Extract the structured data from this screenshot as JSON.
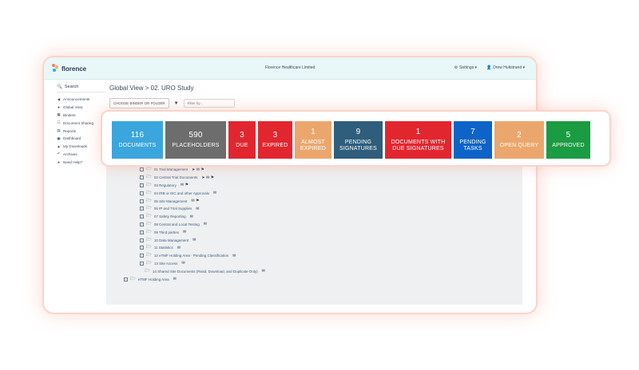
{
  "colors": {
    "documents": "#3aa6dd",
    "placeholders": "#6d6d6d",
    "due": "#e2262f",
    "expired": "#e2262f",
    "almost_expired": "#eba66d",
    "pending_signatures": "#2f5d7c",
    "docs_due_signatures": "#e2262f",
    "pending_tasks": "#0d63c8",
    "open_query": "#eba66d",
    "approved": "#1b9b42"
  },
  "app": {
    "logo_text": "florence",
    "org_name": "Florence Healthcare Limited",
    "settings_label": "Settings ▾",
    "user_label": "Drew Hultstrand ▾"
  },
  "sidebar": {
    "search_label": "Search",
    "items": [
      {
        "icon": "megaphone-icon",
        "glyph": "◀",
        "label": "Announcements"
      },
      {
        "icon": "globe-icon",
        "glyph": "●",
        "label": "Global View"
      },
      {
        "icon": "binders-icon",
        "glyph": "▦",
        "label": "Binders"
      },
      {
        "icon": "document-sharing-icon",
        "glyph": "☷",
        "label": "Document Sharing"
      },
      {
        "icon": "reports-icon",
        "glyph": "▤",
        "label": "Reports"
      },
      {
        "icon": "dashboard-icon",
        "glyph": "▣",
        "label": "Dashboard"
      },
      {
        "icon": "downloads-icon",
        "glyph": "▲",
        "label": "My Downloads"
      },
      {
        "icon": "archives-icon",
        "glyph": "↶",
        "label": "Archives"
      },
      {
        "icon": "help-icon",
        "glyph": "●",
        "label": "Need Help?"
      }
    ]
  },
  "content": {
    "title": "Global View > 02. URO Study",
    "choose_button": "CHOOSE BINDER OR FOLDER",
    "filter_placeholder": "Filter by..."
  },
  "stats": [
    {
      "key": "documents",
      "num": "116",
      "label": "DOCUMENTS",
      "width": 64
    },
    {
      "key": "placeholders",
      "num": "590",
      "label": "PLACEHOLDERS",
      "width": 76
    },
    {
      "key": "due",
      "num": "3",
      "label": "DUE",
      "width": 34
    },
    {
      "key": "expired",
      "num": "3",
      "label": "EXPIRED",
      "width": 43
    },
    {
      "key": "almost_expired",
      "num": "1",
      "label": "ALMOST EXPIRED",
      "width": 46
    },
    {
      "key": "pending_signatures",
      "num": "9",
      "label": "PENDING SIGNATURES",
      "width": 61
    },
    {
      "key": "docs_due_signatures",
      "num": "1",
      "label": "DOCUMENTS WITH DUE SIGNATURES",
      "width": 83
    },
    {
      "key": "pending_tasks",
      "num": "7",
      "label": "PENDING TASKS",
      "width": 48
    },
    {
      "key": "open_query",
      "num": "2",
      "label": "OPEN QUERY",
      "width": 62
    },
    {
      "key": "approved",
      "num": "5",
      "label": "APPROVED",
      "width": 55
    }
  ],
  "tree": [
    {
      "label": "01 Trial Management",
      "badges": "➤ ✉ ⚑",
      "nested": false
    },
    {
      "label": "02 Central Trial Documents",
      "badges": "➤ ✉ ⚑",
      "nested": false
    },
    {
      "label": "03 Regulatory",
      "badges": "✉ ⚑",
      "nested": false
    },
    {
      "label": "04 IRB or IEC and other Approvals",
      "badges": "✉",
      "nested": false
    },
    {
      "label": "05 Site Management",
      "badges": "✉ ⚑",
      "nested": false
    },
    {
      "label": "06 IP and Trial Supplies",
      "badges": "✉",
      "nested": false
    },
    {
      "label": "07 Safety Reporting",
      "badges": "✉",
      "nested": false
    },
    {
      "label": "08 Central and Local Testing",
      "badges": "✉",
      "nested": false
    },
    {
      "label": "09 Third parties",
      "badges": "✉",
      "nested": false
    },
    {
      "label": "10 Data Management",
      "badges": "✉",
      "nested": false
    },
    {
      "label": "11 Statistics",
      "badges": "✉",
      "nested": false
    },
    {
      "label": "12 eTMF Holding Area - Pending Classification",
      "badges": "✉",
      "nested": false
    },
    {
      "label": "13 Site Access",
      "badges": "✉",
      "nested": false
    },
    {
      "label": "14 Shared Site Documents (Read, Download, and Duplicate Only)",
      "badges": "✉",
      "nested": true
    },
    {
      "label": "eTMF Holding Area",
      "badges": "✉",
      "level1": true
    }
  ]
}
